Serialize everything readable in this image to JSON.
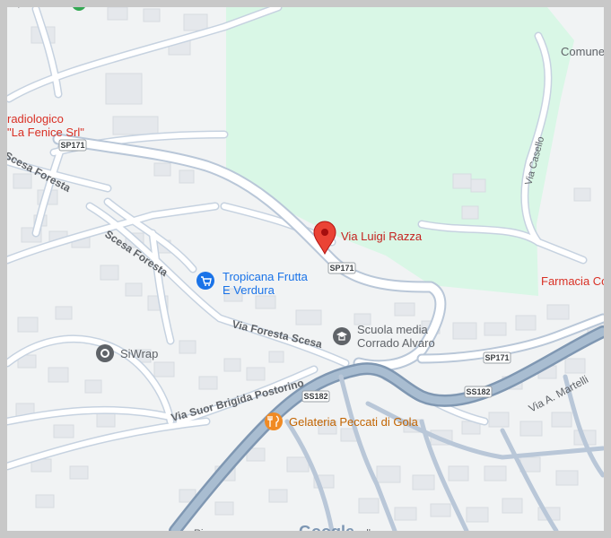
{
  "colors": {
    "frame": "#c8c8c8",
    "land": "#f1f3f4",
    "park": "#d9f7e6",
    "road": "#ffffff",
    "road_casing": "#c6d2e0",
    "road_major": "#9fb3c8",
    "building": "#e5e8ec",
    "building_stroke": "#d6dbe1",
    "pin_red": "#ea4335",
    "poi_blue": "#1a73e8",
    "poi_gray": "#5f6368",
    "poi_orange": "#f08a24",
    "park_green": "#34a853"
  },
  "labels": {
    "top_left_partial": "a sportiva",
    "radiologico": "radiologico",
    "la_fenice": "\"La Fenice Srl\"",
    "comune": "Comune",
    "via_casello": "Via Casello",
    "scesa_foresta_top": "Scesa Foresta",
    "scesa_foresta_mid": "Scesa Foresta",
    "via_foresta_scesa": "Via Foresta Scesa",
    "via_suor_brigida": "Via Suor Brigida Postorino",
    "via_a_martelli": "Via A. Martelli",
    "farmacia": "Farmacia Co",
    "ricc_partial": "Ric",
    "nella_partial": "nella"
  },
  "road_shields": {
    "sp171_a": "SP171",
    "sp171_b": "SP171",
    "sp171_c": "SP171",
    "ss182_a": "SS182",
    "ss182_b": "SS182"
  },
  "pois": {
    "via_luigi_razza": {
      "name": "Via Luigi Razza",
      "icon": "location-pin-icon"
    },
    "tropicana": {
      "name_line1": "Tropicana Frutta",
      "name_line2": "E Verdura",
      "icon": "shopping-cart-icon"
    },
    "scuola": {
      "name_line1": "Scuola media",
      "name_line2": "Corrado Alvaro",
      "icon": "graduation-cap-icon"
    },
    "siwrap": {
      "name": "SiWrap",
      "icon": "location-dot-icon"
    },
    "gelateria": {
      "name": "Gelateria Peccati di Gola",
      "icon": "cutlery-icon"
    }
  },
  "logo": {
    "text": "Google"
  }
}
